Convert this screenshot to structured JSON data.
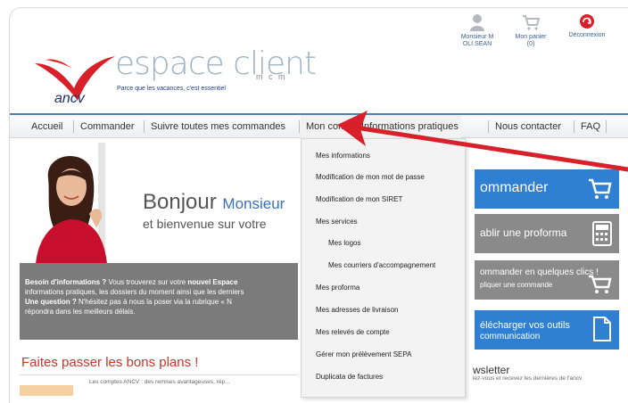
{
  "header": {
    "brand": "espace client",
    "brand_sub": "m c m",
    "tagline": "Parce que les vacances, c'est essentiel",
    "logo_text": "ancv",
    "user_link": "Monsieur M\nOLI SEAN",
    "cart_link": "Mon panier\n(0)",
    "logout_link": "Déconnexion"
  },
  "nav": {
    "items": [
      "Accueil",
      "Commander",
      "Suivre toutes mes commandes",
      "Mon compte",
      "Informations pratiques",
      "Nous contacter",
      "FAQ"
    ],
    "active_index": 3
  },
  "hero": {
    "greeting": "Bonjour",
    "greeting_name": "Monsieur",
    "welcome": "et bienvenue sur votre"
  },
  "info_box": {
    "line1_bold": "Besoin d'informations ?",
    "line1": " Vous trouverez sur votre ",
    "line1_bold2": "nouvel Espace",
    "line2": "informations pratiques, les dossiers du moment ainsi que les derniers",
    "line3_bold": "Une question ?",
    "line3": " N'hésitez pas à nous la poser via la rubrique « N",
    "line4": "répondra dans les meilleurs délais."
  },
  "deals": {
    "title": "Faites passer les bons plans !",
    "text": "Les comptes ANCV : des remises avantageuses, rép..."
  },
  "cta": {
    "order": "ommander",
    "proforma": "ablir une proforma",
    "quick_order": "ommander en quelques clics !",
    "quick_order_sub": "pliquer une commande",
    "download": "élécharger vos outils",
    "download_sub": "communication"
  },
  "newsletter": {
    "title": "wsletter",
    "text": "lez-vous et recevez les dernières de l'ancv"
  },
  "dropdown": {
    "items": [
      {
        "label": "Mes informations",
        "sub": false
      },
      {
        "label": "Modification de mon mot de passe",
        "sub": false
      },
      {
        "label": "Modification de mon SIRET",
        "sub": false
      },
      {
        "label": "Mes services",
        "sub": false
      },
      {
        "label": "Mes logos",
        "sub": true
      },
      {
        "label": "Mes courriers d'accompagnement",
        "sub": true
      },
      {
        "label": "Mes proforma",
        "sub": false
      },
      {
        "label": "Mes adresses de livraison",
        "sub": false
      },
      {
        "label": "Mes relevés de compte",
        "sub": false
      },
      {
        "label": "Gérer mon prélèvement SEPA",
        "sub": false
      },
      {
        "label": "Duplicata de factures",
        "sub": false
      }
    ]
  },
  "colors": {
    "nav_accent": "#4d7fba",
    "cta_blue": "#2f7fd3",
    "cta_gray": "#8a8a8a",
    "arrow_red": "#d8202a",
    "logo_red": "#d8202a",
    "logo_navy": "#1f2f6b"
  }
}
